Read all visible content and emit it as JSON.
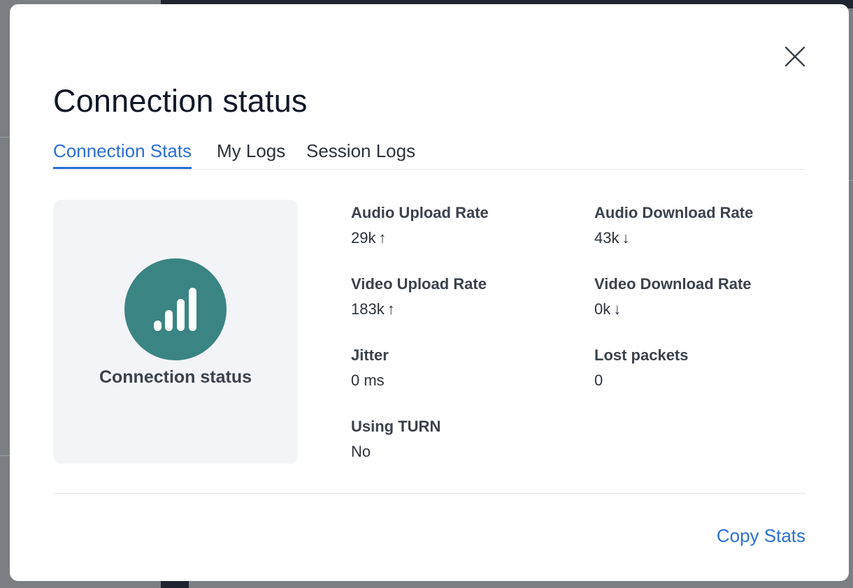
{
  "modal": {
    "title": "Connection status",
    "tabs": [
      {
        "label": "Connection Stats",
        "active": true
      },
      {
        "label": "My Logs",
        "active": false
      },
      {
        "label": "Session Logs",
        "active": false
      }
    ],
    "status_card": {
      "icon": "signal-bars-icon",
      "label": "Connection status",
      "icon_color": "#3a8583"
    },
    "stats": [
      {
        "label": "Audio Upload Rate",
        "value": "29k",
        "direction": "up"
      },
      {
        "label": "Audio Download Rate",
        "value": "43k",
        "direction": "down"
      },
      {
        "label": "Video Upload Rate",
        "value": "183k",
        "direction": "up"
      },
      {
        "label": "Video Download Rate",
        "value": "0k",
        "direction": "down"
      },
      {
        "label": "Jitter",
        "value": "0 ms"
      },
      {
        "label": "Lost packets",
        "value": "0"
      },
      {
        "label": "Using TURN",
        "value": "No"
      }
    ],
    "copy_button": "Copy Stats",
    "accent_color": "#2b6fd6"
  },
  "arrows": {
    "up": "↑",
    "down": "↓"
  }
}
